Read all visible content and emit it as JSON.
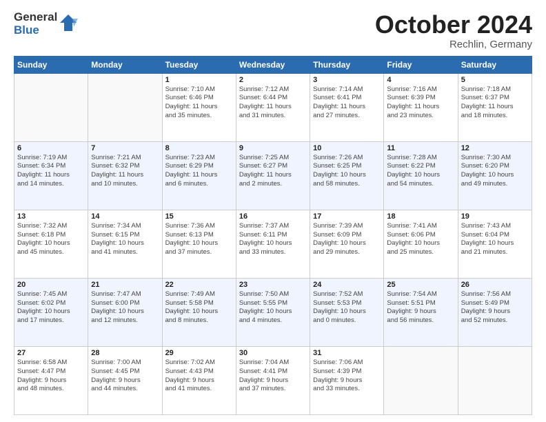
{
  "logo": {
    "general": "General",
    "blue": "Blue"
  },
  "title": "October 2024",
  "location": "Rechlin, Germany",
  "weekdays": [
    "Sunday",
    "Monday",
    "Tuesday",
    "Wednesday",
    "Thursday",
    "Friday",
    "Saturday"
  ],
  "days": [
    {
      "num": "",
      "detail": ""
    },
    {
      "num": "",
      "detail": ""
    },
    {
      "num": "1",
      "detail": "Sunrise: 7:10 AM\nSunset: 6:46 PM\nDaylight: 11 hours\nand 35 minutes."
    },
    {
      "num": "2",
      "detail": "Sunrise: 7:12 AM\nSunset: 6:44 PM\nDaylight: 11 hours\nand 31 minutes."
    },
    {
      "num": "3",
      "detail": "Sunrise: 7:14 AM\nSunset: 6:41 PM\nDaylight: 11 hours\nand 27 minutes."
    },
    {
      "num": "4",
      "detail": "Sunrise: 7:16 AM\nSunset: 6:39 PM\nDaylight: 11 hours\nand 23 minutes."
    },
    {
      "num": "5",
      "detail": "Sunrise: 7:18 AM\nSunset: 6:37 PM\nDaylight: 11 hours\nand 18 minutes."
    },
    {
      "num": "6",
      "detail": "Sunrise: 7:19 AM\nSunset: 6:34 PM\nDaylight: 11 hours\nand 14 minutes."
    },
    {
      "num": "7",
      "detail": "Sunrise: 7:21 AM\nSunset: 6:32 PM\nDaylight: 11 hours\nand 10 minutes."
    },
    {
      "num": "8",
      "detail": "Sunrise: 7:23 AM\nSunset: 6:29 PM\nDaylight: 11 hours\nand 6 minutes."
    },
    {
      "num": "9",
      "detail": "Sunrise: 7:25 AM\nSunset: 6:27 PM\nDaylight: 11 hours\nand 2 minutes."
    },
    {
      "num": "10",
      "detail": "Sunrise: 7:26 AM\nSunset: 6:25 PM\nDaylight: 10 hours\nand 58 minutes."
    },
    {
      "num": "11",
      "detail": "Sunrise: 7:28 AM\nSunset: 6:22 PM\nDaylight: 10 hours\nand 54 minutes."
    },
    {
      "num": "12",
      "detail": "Sunrise: 7:30 AM\nSunset: 6:20 PM\nDaylight: 10 hours\nand 49 minutes."
    },
    {
      "num": "13",
      "detail": "Sunrise: 7:32 AM\nSunset: 6:18 PM\nDaylight: 10 hours\nand 45 minutes."
    },
    {
      "num": "14",
      "detail": "Sunrise: 7:34 AM\nSunset: 6:15 PM\nDaylight: 10 hours\nand 41 minutes."
    },
    {
      "num": "15",
      "detail": "Sunrise: 7:36 AM\nSunset: 6:13 PM\nDaylight: 10 hours\nand 37 minutes."
    },
    {
      "num": "16",
      "detail": "Sunrise: 7:37 AM\nSunset: 6:11 PM\nDaylight: 10 hours\nand 33 minutes."
    },
    {
      "num": "17",
      "detail": "Sunrise: 7:39 AM\nSunset: 6:09 PM\nDaylight: 10 hours\nand 29 minutes."
    },
    {
      "num": "18",
      "detail": "Sunrise: 7:41 AM\nSunset: 6:06 PM\nDaylight: 10 hours\nand 25 minutes."
    },
    {
      "num": "19",
      "detail": "Sunrise: 7:43 AM\nSunset: 6:04 PM\nDaylight: 10 hours\nand 21 minutes."
    },
    {
      "num": "20",
      "detail": "Sunrise: 7:45 AM\nSunset: 6:02 PM\nDaylight: 10 hours\nand 17 minutes."
    },
    {
      "num": "21",
      "detail": "Sunrise: 7:47 AM\nSunset: 6:00 PM\nDaylight: 10 hours\nand 12 minutes."
    },
    {
      "num": "22",
      "detail": "Sunrise: 7:49 AM\nSunset: 5:58 PM\nDaylight: 10 hours\nand 8 minutes."
    },
    {
      "num": "23",
      "detail": "Sunrise: 7:50 AM\nSunset: 5:55 PM\nDaylight: 10 hours\nand 4 minutes."
    },
    {
      "num": "24",
      "detail": "Sunrise: 7:52 AM\nSunset: 5:53 PM\nDaylight: 10 hours\nand 0 minutes."
    },
    {
      "num": "25",
      "detail": "Sunrise: 7:54 AM\nSunset: 5:51 PM\nDaylight: 9 hours\nand 56 minutes."
    },
    {
      "num": "26",
      "detail": "Sunrise: 7:56 AM\nSunset: 5:49 PM\nDaylight: 9 hours\nand 52 minutes."
    },
    {
      "num": "27",
      "detail": "Sunrise: 6:58 AM\nSunset: 4:47 PM\nDaylight: 9 hours\nand 48 minutes."
    },
    {
      "num": "28",
      "detail": "Sunrise: 7:00 AM\nSunset: 4:45 PM\nDaylight: 9 hours\nand 44 minutes."
    },
    {
      "num": "29",
      "detail": "Sunrise: 7:02 AM\nSunset: 4:43 PM\nDaylight: 9 hours\nand 41 minutes."
    },
    {
      "num": "30",
      "detail": "Sunrise: 7:04 AM\nSunset: 4:41 PM\nDaylight: 9 hours\nand 37 minutes."
    },
    {
      "num": "31",
      "detail": "Sunrise: 7:06 AM\nSunset: 4:39 PM\nDaylight: 9 hours\nand 33 minutes."
    },
    {
      "num": "",
      "detail": ""
    },
    {
      "num": "",
      "detail": ""
    }
  ]
}
